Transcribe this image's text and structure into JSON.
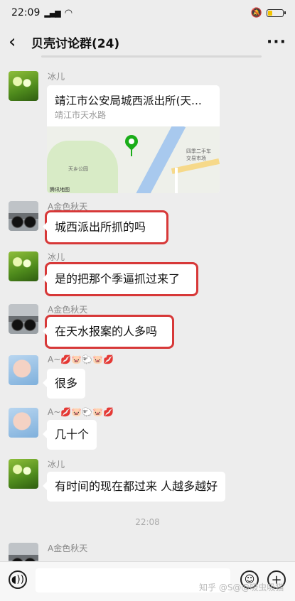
{
  "status": {
    "time": "22:09",
    "signal": "4G",
    "wifi_icon": "wifi-icon",
    "mute_icon": "mute-icon",
    "battery_level": 0.25
  },
  "header": {
    "back_icon": "‹",
    "title": "贝壳讨论群(24)",
    "more_icon": "···"
  },
  "messages": [
    {
      "sender": "冰儿",
      "type": "location",
      "title": "靖江市公安局城西派出所(天...",
      "address": "靖江市天水路"
    },
    {
      "sender": "A金色秋天",
      "text": "城西派出所抓的吗",
      "highlighted": true
    },
    {
      "sender": "冰儿",
      "text": "是的把那个季逼抓过来了",
      "highlighted": true
    },
    {
      "sender": "A金色秋天",
      "text": "在天水报案的人多吗",
      "highlighted": true
    },
    {
      "sender": "A~💋🐷🐑🐷💋",
      "text": "很多"
    },
    {
      "sender": "A~💋🐷🐑🐷💋",
      "text": "几十个"
    },
    {
      "sender": "冰儿",
      "text": "有时间的现在都过来 人越多越好"
    },
    {
      "sender": "A金色秋天"
    }
  ],
  "map_labels": {
    "park": "天乡公园",
    "logo": "腾讯地图",
    "shop": "四季二手车交易市场"
  },
  "timestamp": "22:08",
  "input": {
    "voice_icon": "voice-icon",
    "emoji_icon": "emoji-icon",
    "plus_icon": "plus-icon",
    "placeholder": ""
  },
  "watermark": "知乎 @S@@吸虫吸猫"
}
